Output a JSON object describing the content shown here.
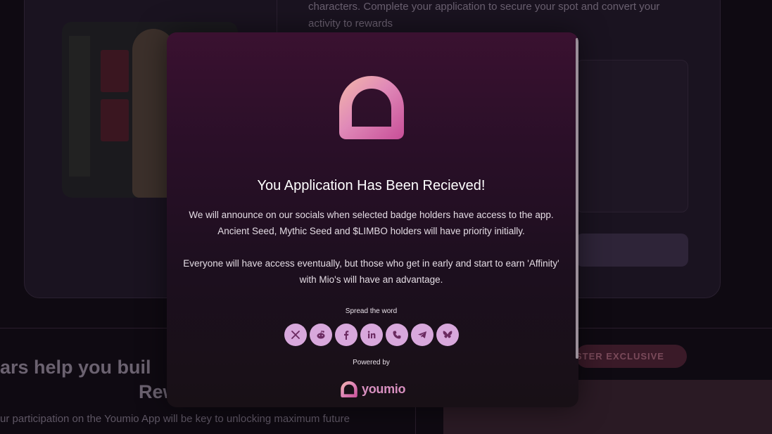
{
  "background": {
    "intro_text_line1": "characters. Complete your application to secure your spot and convert your",
    "intro_text_line2": "activity to rewards",
    "heading_line1": "ars help you buil",
    "heading_line2": "Rew",
    "paragraph": "ur participation on the Youmio App will be key to unlocking maximum future",
    "pill_label": "STER EXCLUSIVE"
  },
  "modal": {
    "title": "You Application Has Been Recieved!",
    "paragraph1": "We will announce on our socials when selected badge holders have access to the app. Ancient Seed, Mythic Seed and $LIMBO holders will have priority initially.",
    "paragraph2": "Everyone will have access eventually, but those who get in early and start to earn 'Affinity' with Mio's will have an advantage.",
    "spread_label": "Spread the word",
    "share_icons": [
      "x-icon",
      "reddit-icon",
      "facebook-icon",
      "linkedin-icon",
      "phone-icon",
      "telegram-icon",
      "bluesky-icon"
    ],
    "powered_label": "Powered by",
    "brand_name": "youmio"
  },
  "colors": {
    "accent_pink": "#d890c0",
    "share_button_bg": "#d8a8dc",
    "share_icon": "#6a2a60"
  }
}
